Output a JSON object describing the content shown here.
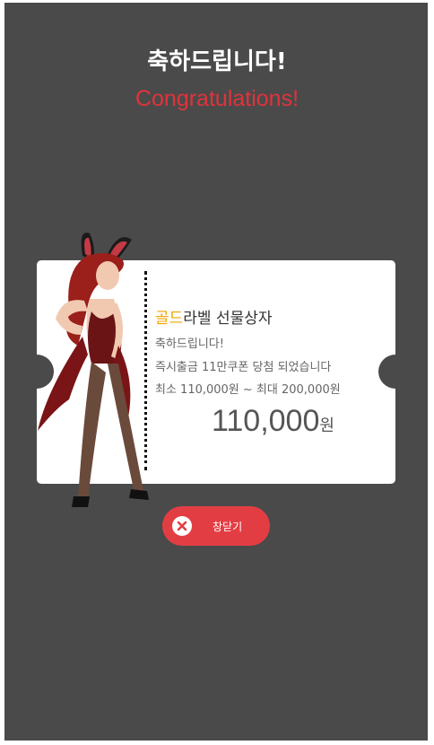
{
  "title_ko": "축하드립니다!",
  "title_en": "Congratulations!",
  "ticket": {
    "label_gold": "골드",
    "label_rest": "라벨 선물상자",
    "line2": "축하드립니다!",
    "line3": "즉시출금 11만쿠폰 당첨 되었습니다",
    "line4": "최소 110,000원 ~ 최대 200,000원",
    "amount": "110,000",
    "amount_unit": "원"
  },
  "close_button": {
    "label": "창닫기",
    "icon": "close-icon"
  },
  "colors": {
    "background": "#4a4a4a",
    "accent_red": "#e33d44",
    "title_red": "#e0333b",
    "gold": "#f2a300"
  }
}
